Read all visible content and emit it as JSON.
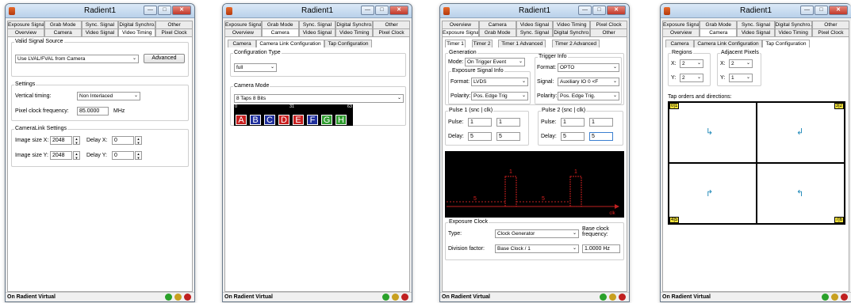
{
  "window_title": "Radient1",
  "status_text": "On Radient Virtual",
  "status_colors": [
    "#2aa12a",
    "#c8a020",
    "#c02020"
  ],
  "tabs_top": [
    "Exposure Signal",
    "Grab Mode",
    "Sync. Signal",
    "Digital Synchro.",
    "Other"
  ],
  "tabs_bottom": [
    "Overview",
    "Camera",
    "Video Signal",
    "Video Timing",
    "Pixel Clock"
  ],
  "w1": {
    "valid_signal_group": "Valid Signal Source",
    "valid_signal_value": "Use LVAL/FVAL from Camera",
    "advanced": "Advanced",
    "settings_group": "Settings",
    "vertical_timing_label": "Vertical timing:",
    "vertical_timing_value": "Non Interlaced",
    "pixel_clock_label": "Pixel clock frequency:",
    "pixel_clock_value": "85.0000",
    "pixel_clock_unit": "MHz",
    "cl_group": "CameraLink Settings",
    "image_size_x_label": "Image size X:",
    "image_size_x": "2048",
    "delay_x_label": "Delay X:",
    "delay_x": "0",
    "image_size_y_label": "Image size Y:",
    "image_size_y": "2048",
    "delay_y_label": "Delay Y:",
    "delay_y": "0"
  },
  "camera_subtabs": [
    "Camera",
    "Camera Link Configuration",
    "Tap Configuration"
  ],
  "w2": {
    "config_type_group": "Configuration Type",
    "config_type_value": "full",
    "camera_mode_group": "Camera Mode",
    "camera_mode_value": "8 Taps 8 Bits",
    "bits_start": "0",
    "bits_mid": "31",
    "bits_end": "63",
    "taps": [
      {
        "label": "A",
        "color": "#c81e1e"
      },
      {
        "label": "B",
        "color": "#1f2f9c"
      },
      {
        "label": "C",
        "color": "#1f2f9c"
      },
      {
        "label": "D",
        "color": "#c81e1e"
      },
      {
        "label": "E",
        "color": "#c81e1e"
      },
      {
        "label": "F",
        "color": "#1f2f9c"
      },
      {
        "label": "G",
        "color": "#2f9c2f"
      },
      {
        "label": "H",
        "color": "#2f9c2f"
      }
    ]
  },
  "w3": {
    "top_tabs": [
      "Overview",
      "Camera",
      "Video Signal",
      "Video Timing",
      "Pixel Clock"
    ],
    "bottom_tabs": [
      "Exposure Signal",
      "Grab Mode",
      "Sync. Signal",
      "Digital Synchro.",
      "Other"
    ],
    "timer_tabs": [
      "Timer 1",
      "Timer 2",
      "Timer 1 Advanced",
      "Timer 2 Advanced"
    ],
    "generation_group": "Generation",
    "mode_label": "Mode:",
    "mode_value": "On Trigger Event",
    "exposure_info_group": "Exposure Signal Info",
    "format_label": "Format:",
    "format_value": "LVDS",
    "polarity_label": "Polarity:",
    "polarity_value": "Pos. Edge Trig",
    "trigger_group": "Trigger Info",
    "trig_format_label": "Format:",
    "trig_format_value": "OPTO",
    "signal_label": "Signal:",
    "signal_value": "Auxiliary IO 0 <F",
    "trig_polarity_label": "Polarity:",
    "trig_polarity_value": "Pos. Edge Trig.",
    "pulse1_group": "Pulse 1 (snc | clk)",
    "pulse2_group": "Pulse 2 (snc | clk)",
    "pulse_label": "Pulse:",
    "delay_label": "Delay:",
    "p1_pulse": [
      "1",
      "1"
    ],
    "p1_delay": [
      "5",
      "5"
    ],
    "p2_pulse": [
      "1",
      "1"
    ],
    "p2_delay": [
      "5",
      "5"
    ],
    "scope_labels": [
      "1",
      "1",
      "5",
      "5"
    ],
    "scope_axis_label": "clk",
    "exposure_clock_group": "Exposure Clock",
    "type_label": "Type:",
    "type_value": "Clock Generator",
    "base_clock_label": "Base clock frequency:",
    "division_label": "Division factor:",
    "division_value": "Base Clock / 1",
    "base_clock_value": "1.0000 Hz"
  },
  "w4": {
    "regions_group": "Regions",
    "regions_x_label": "X:",
    "regions_x": "2",
    "regions_y_label": "Y:",
    "regions_y": "2",
    "adjacent_group": "Adjacent Pixels",
    "adjacent_x_label": "X:",
    "adjacent_x": "2",
    "adjacent_y_label": "Y:",
    "adjacent_y": "1",
    "tap_orders_label": "Tap orders and directions:",
    "corners": [
      "0|1",
      "3|2",
      "4|5",
      "7|6"
    ]
  }
}
